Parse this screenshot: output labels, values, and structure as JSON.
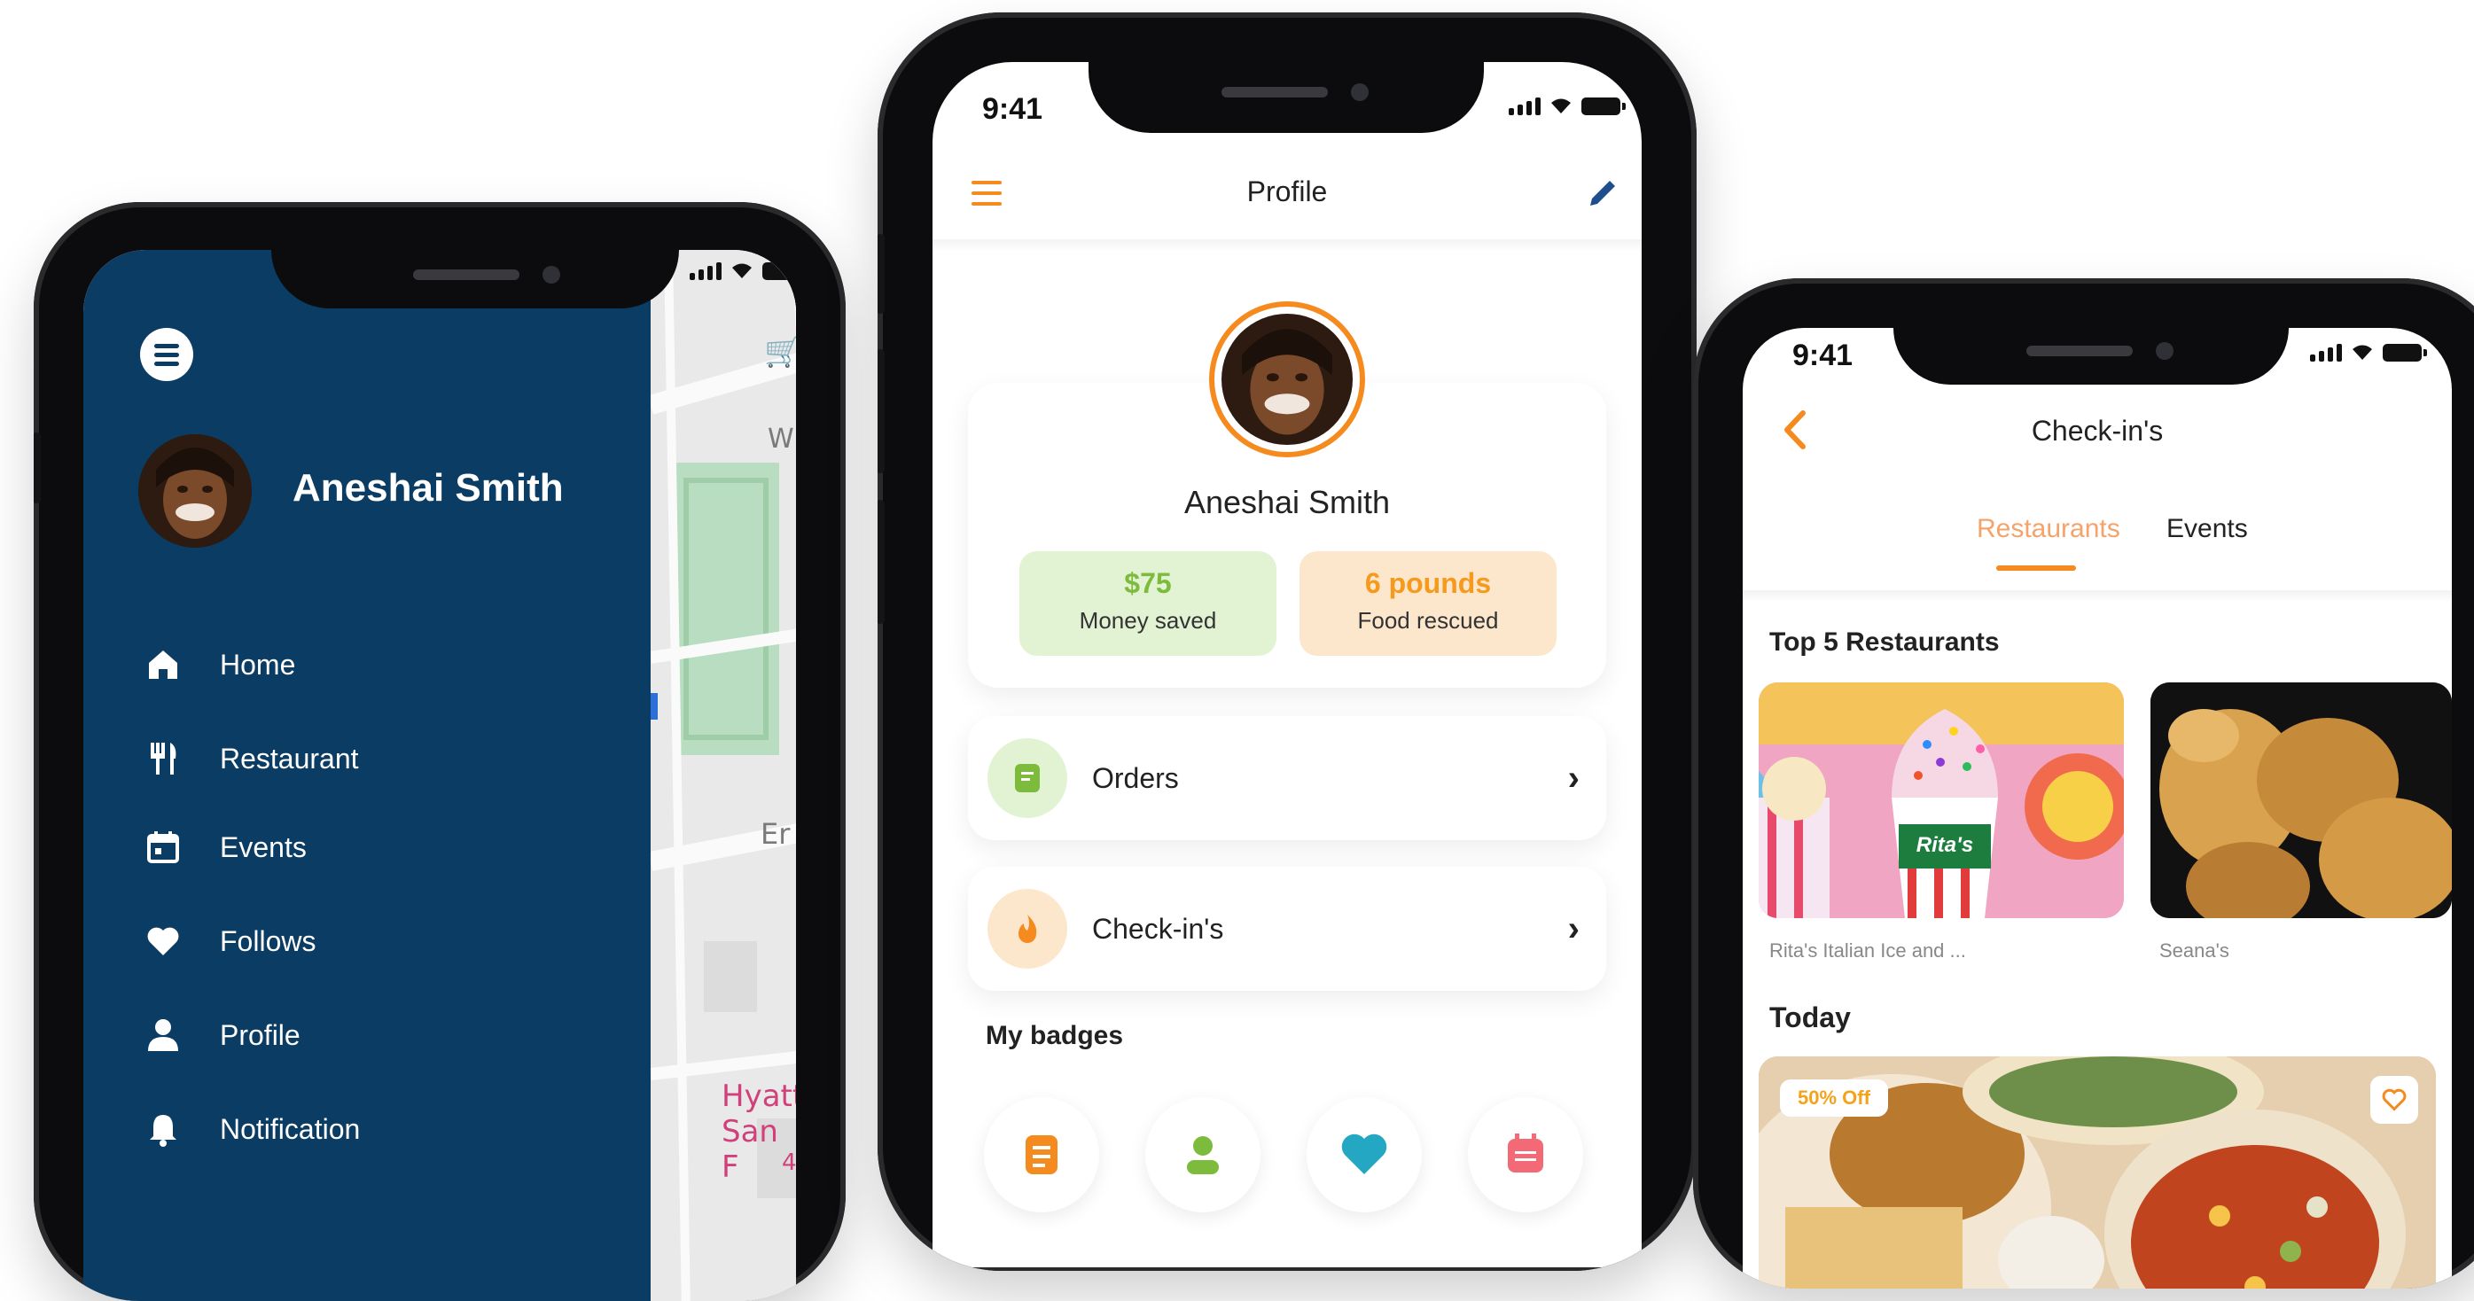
{
  "left_phone": {
    "user_name": "Aneshai Smith",
    "menu": [
      {
        "label": "Home",
        "icon": "home-icon"
      },
      {
        "label": "Restaurant",
        "icon": "fork-knife-icon"
      },
      {
        "label": "Events",
        "icon": "calendar-icon"
      },
      {
        "label": "Follows",
        "icon": "heart-icon"
      },
      {
        "label": "Profile",
        "icon": "person-icon"
      },
      {
        "label": "Notification",
        "icon": "bell-icon"
      }
    ],
    "map_labels": {
      "street": "W",
      "er": "Er",
      "hyatt_1": "Hyatt",
      "hyatt_2": "San F",
      "num": "4"
    },
    "colors": {
      "drawer": "#0b3c63",
      "accent": "#f5a21b"
    }
  },
  "middle_phone": {
    "time": "9:41",
    "title": "Profile",
    "user_name": "Aneshai Smith",
    "stats": [
      {
        "value": "$75",
        "label": "Money saved"
      },
      {
        "value": "6 pounds",
        "label": "Food rescued"
      }
    ],
    "rows": [
      {
        "label": "Orders",
        "icon": "receipt-icon"
      },
      {
        "label": "Check-in's",
        "icon": "flame-icon"
      }
    ],
    "badges_title": "My badges",
    "badges": [
      "list-badge-icon",
      "person-badge-icon",
      "heart-badge-icon",
      "calendar-badge-icon"
    ],
    "colors": {
      "accent": "#f58a1f",
      "green_bg": "#e2f3d3",
      "green_text": "#7dbb3c",
      "orange_bg": "#fde7cc",
      "orange_text": "#f59a1d"
    }
  },
  "right_phone": {
    "time": "9:41",
    "title": "Check-in's",
    "tabs": [
      "Restaurants",
      "Events"
    ],
    "active_tab": "Restaurants",
    "top_title": "Top 5 Restaurants",
    "restaurants": [
      {
        "name": "Rita's Italian Ice and ...",
        "sign": "Rita's"
      },
      {
        "name": "Seana's"
      }
    ],
    "today_title": "Today",
    "today_badge": "50% Off"
  }
}
